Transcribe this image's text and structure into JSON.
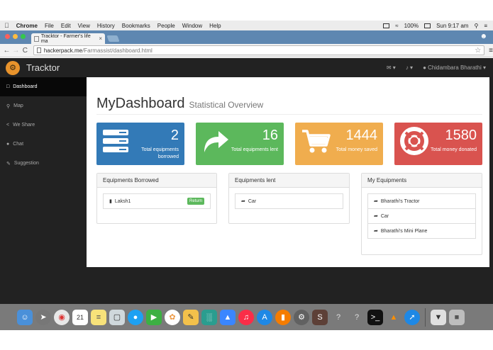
{
  "menubar": {
    "app": "Chrome",
    "items": [
      "File",
      "Edit",
      "View",
      "History",
      "Bookmarks",
      "People",
      "Window",
      "Help"
    ],
    "battery": "100%",
    "datetime": "Sun 9:17 am"
  },
  "browser": {
    "tab_title": "Tracktor - Farmer's life ma",
    "url_host": "hackerpack.me",
    "url_path": "/Farmassist/dashboard.html"
  },
  "navbar": {
    "brand": "Tracktor",
    "user": "Chidambara Bharathi"
  },
  "sidebar": {
    "items": [
      {
        "label": "Dashboard",
        "icon": "bar-chart-icon"
      },
      {
        "label": "Map",
        "icon": "map-marker-icon"
      },
      {
        "label": "We Share",
        "icon": "share-icon"
      },
      {
        "label": "Chat",
        "icon": "chat-icon"
      },
      {
        "label": "Suggestion",
        "icon": "pencil-icon"
      }
    ]
  },
  "page": {
    "title": "MyDashboard",
    "subtitle": "Statistical Overview"
  },
  "stats": [
    {
      "value": "2",
      "label": "Total equipments borrowed",
      "icon": "server-icon",
      "color": "#337ab7"
    },
    {
      "value": "16",
      "label": "Total equipments lent",
      "icon": "share-arrow-icon",
      "color": "#5cb85c"
    },
    {
      "value": "1444",
      "label": "Total money saved",
      "icon": "cart-icon",
      "color": "#f0ad4e"
    },
    {
      "value": "1580",
      "label": "Total money donated",
      "icon": "lifebuoy-icon",
      "color": "#d9534f"
    }
  ],
  "panels": {
    "borrowed": {
      "title": "Equipments Borrowed",
      "items": [
        {
          "label": "Laksh1",
          "action": "Return"
        }
      ]
    },
    "lent": {
      "title": "Equipments lent",
      "items": [
        {
          "label": "Car"
        }
      ]
    },
    "mine": {
      "title": "My Equipments",
      "items": [
        {
          "label": "Bharathi's Tractor"
        },
        {
          "label": "Car"
        },
        {
          "label": "Bharathi's Mini Plane"
        }
      ]
    }
  },
  "dock": {
    "calendar_day": "21"
  }
}
